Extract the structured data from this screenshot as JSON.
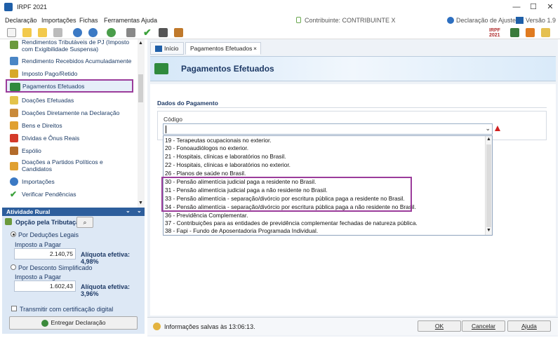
{
  "window": {
    "title": "IRPF 2021",
    "minimize": "—",
    "maximize": "☐",
    "close": "✕"
  },
  "menu": {
    "items": [
      "Declaração",
      "Importações",
      "Fichas",
      "Ferramentas",
      "Ajuda"
    ],
    "contribuinte": "Contribuinte: CONTRIBUINTE X",
    "declaracao": "Declaração de Ajuste",
    "versao": "Versão 1.9"
  },
  "sidebar": {
    "items": [
      "Rendimentos Tributáveis de PJ (Imposto",
      "com Exigibilidade Suspensa)",
      "Rendimento Recebidos Acumuladamente",
      "Imposto Pago/Retido",
      "Pagamentos Efetuados",
      "Doações Efetuadas",
      "Doações Diretamente na Declaração",
      "Bens e Direitos",
      "Dívidas e Ônus Reais",
      "Espólio",
      "Doações a Partidos Políticos e",
      "Candidatos",
      "Importações",
      "Verificar Pendências"
    ]
  },
  "rural": {
    "title": "Atividade Rural",
    "opcao_label": "Opção pela Tributação:",
    "deducoes_label": "Por Deduções Legais",
    "imposto_label1": "Imposto a Pagar",
    "imposto_value1": "2.140,75",
    "aliquota1": "Alíquota efetiva: 4,98%",
    "desconto_label": "Por Desconto Simplificado",
    "imposto_label2": "Imposto a Pagar",
    "imposto_value2": "1.602,43",
    "aliquota2": "Alíquota efetiva: 3,96%",
    "certificado_label": "Transmitir com certificação digital",
    "entregar_label": "Entregar Declaração"
  },
  "tabs": {
    "inicio": "Início",
    "pagamentos": "Pagamentos Efetuados",
    "close": "×"
  },
  "banner": {
    "title": "Pagamentos Efetuados"
  },
  "form": {
    "section_title": "Dados do Pagamento",
    "codigo_label": "Código",
    "codigo_value": ""
  },
  "dropdown": {
    "options": [
      "19 - Terapeutas ocupacionais no exterior.",
      "20 - Fonoaudiólogos no exterior.",
      "21 - Hospitais, clínicas e laboratórios no Brasil.",
      "22 - Hospitais, clínicas e laboratórios no exterior.",
      "26 - Planos de saúde no Brasil.",
      "30 - Pensão alimentícia judicial paga a residente no Brasil.",
      "31 - Pensão alimentícia judicial paga a não residente no Brasil.",
      "33 - Pensão alimentícia - separação/divórcio por escritura pública paga a residente no Brasil.",
      "34 - Pensão alimentícia - separação/divórcio por escritura pública paga a não residente no Brasil.",
      "36 - Previdência Complementar.",
      "37 - Contribuições para as entidades de previdência complementar fechadas de natureza pública.",
      "38 - Fapi - Fundo de Aposentadoria Programada Individual."
    ]
  },
  "status": {
    "saved": "Informações salvas às 13:06:13.",
    "ok": "OK",
    "cancel": "Cancelar",
    "help": "Ajuda"
  },
  "colors": {
    "accent": "#9b3c9b",
    "brand": "#2d5e9c"
  }
}
